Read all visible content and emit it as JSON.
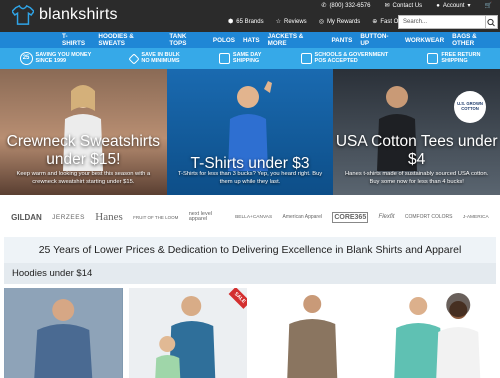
{
  "header": {
    "brand": "blankshirts",
    "phone": "(800) 332-6576",
    "contact": "Contact Us",
    "account": "Account",
    "brands_link": "65 Brands",
    "reviews": "Reviews",
    "rewards": "My Rewards",
    "fast_order": "Fast Order",
    "search_placeholder": "Search..."
  },
  "nav": {
    "items": [
      "T-SHIRTS",
      "HOODIES & SWEATS",
      "TANK TOPS",
      "POLOS",
      "HATS",
      "JACKETS & MORE",
      "PANTS",
      "BUTTON-UP",
      "WORKWEAR",
      "BAGS & OTHER"
    ]
  },
  "perks": {
    "items": [
      {
        "top": "Saving you money",
        "bottom": "since 1999",
        "big": "25"
      },
      {
        "top": "Save in bulk",
        "bottom": "no minimums"
      },
      {
        "top": "Same day",
        "bottom": "shipping"
      },
      {
        "top": "Schools & government",
        "bottom": "POs accepted"
      },
      {
        "top": "Free return",
        "bottom": "shipping"
      }
    ]
  },
  "banners": [
    {
      "title": "Crewneck Sweatshirts\nunder $15!",
      "sub": "Keep warm and looking your best this season with a crewneck sweatshirt starting under $15."
    },
    {
      "title": "T-Shirts under $3",
      "sub": "T-Shirts for less than 3 bucks? Yep, you heard right. Buy them up while they last."
    },
    {
      "title": "USA Cotton Tees under\n$4",
      "sub": "Hanes t-shirts made of sustainably sourced USA cotton. Buy some now for less than 4 bucks!",
      "badge": "U.S. GROWN COTTON"
    }
  ],
  "brands": {
    "items": [
      "GILDAN",
      "JERZEES",
      "Hanes",
      "FRUIT OF THE LOOM",
      "next level apparel",
      "BELLA+CANVAS",
      "American Apparel",
      "CORE365",
      "Flexfit",
      "COMFORT COLORS",
      "J-AMERICA"
    ]
  },
  "headline": "25 Years of Lower Prices & Dedication to Delivering Excellence in Blank Shirts and Apparel",
  "section": {
    "title": "Hoodies under $14",
    "sale_badge": "SALE"
  },
  "colors": {
    "topbar": "#2b2b2b",
    "nav": "#1f87d6",
    "perks": "#36a9e8"
  }
}
